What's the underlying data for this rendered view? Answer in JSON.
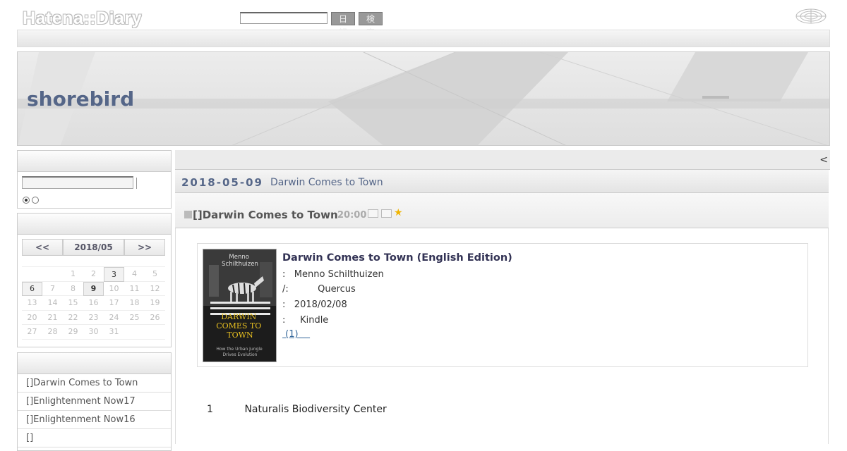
{
  "header": {
    "logo": "Hatena::Diary",
    "search_placeholder": "",
    "diary_button": "日記",
    "search_button": "検索"
  },
  "banner": {
    "title": "shorebird"
  },
  "sidebar": {
    "calendar": {
      "prev": "<<",
      "month": "2018/05",
      "next": ">>",
      "weeks": [
        [
          "",
          "",
          "1",
          "2",
          "3",
          "4",
          "5"
        ],
        [
          "6",
          "7",
          "8",
          "9",
          "10",
          "11",
          "12"
        ],
        [
          "13",
          "14",
          "15",
          "16",
          "17",
          "18",
          "19"
        ],
        [
          "20",
          "21",
          "22",
          "23",
          "24",
          "25",
          "26"
        ],
        [
          "27",
          "28",
          "29",
          "30",
          "31",
          "",
          ""
        ]
      ],
      "entry_days": [
        "3",
        "6"
      ],
      "today": "9"
    },
    "recent": [
      "[]Darwin Comes to Town",
      "[]Enlightenment Now17",
      "[]Enlightenment Now16",
      "[]"
    ]
  },
  "main": {
    "prev_link": "<",
    "date": "2018-05-09",
    "day_title": "Darwin Comes to Town",
    "section_title": "[]Darwin Comes to Town",
    "section_time": "20:00",
    "book": {
      "title": "Darwin Comes to Town (English Edition)",
      "cover_author": "Menno\nSchilthuizen",
      "cover_title": "DARWIN\nCOMES TO\nTOWN",
      "cover_subtitle": "How the Urban Jungle\nDrives Evolution",
      "rows": [
        {
          "label": ":",
          "value": "Menno Schilthuizen"
        },
        {
          "label": "/:",
          "value": "Quercus"
        },
        {
          "label": ":",
          "value": "2018/02/08"
        },
        {
          "label": ":",
          "value": "Kindle"
        }
      ],
      "review_link": " (1)    "
    },
    "text": {
      "num": "1",
      "content": "Naturalis Biodiversity Center"
    }
  },
  "colors": {
    "title_blue": "#556688",
    "star": "#f0b400",
    "link": "#336699"
  }
}
